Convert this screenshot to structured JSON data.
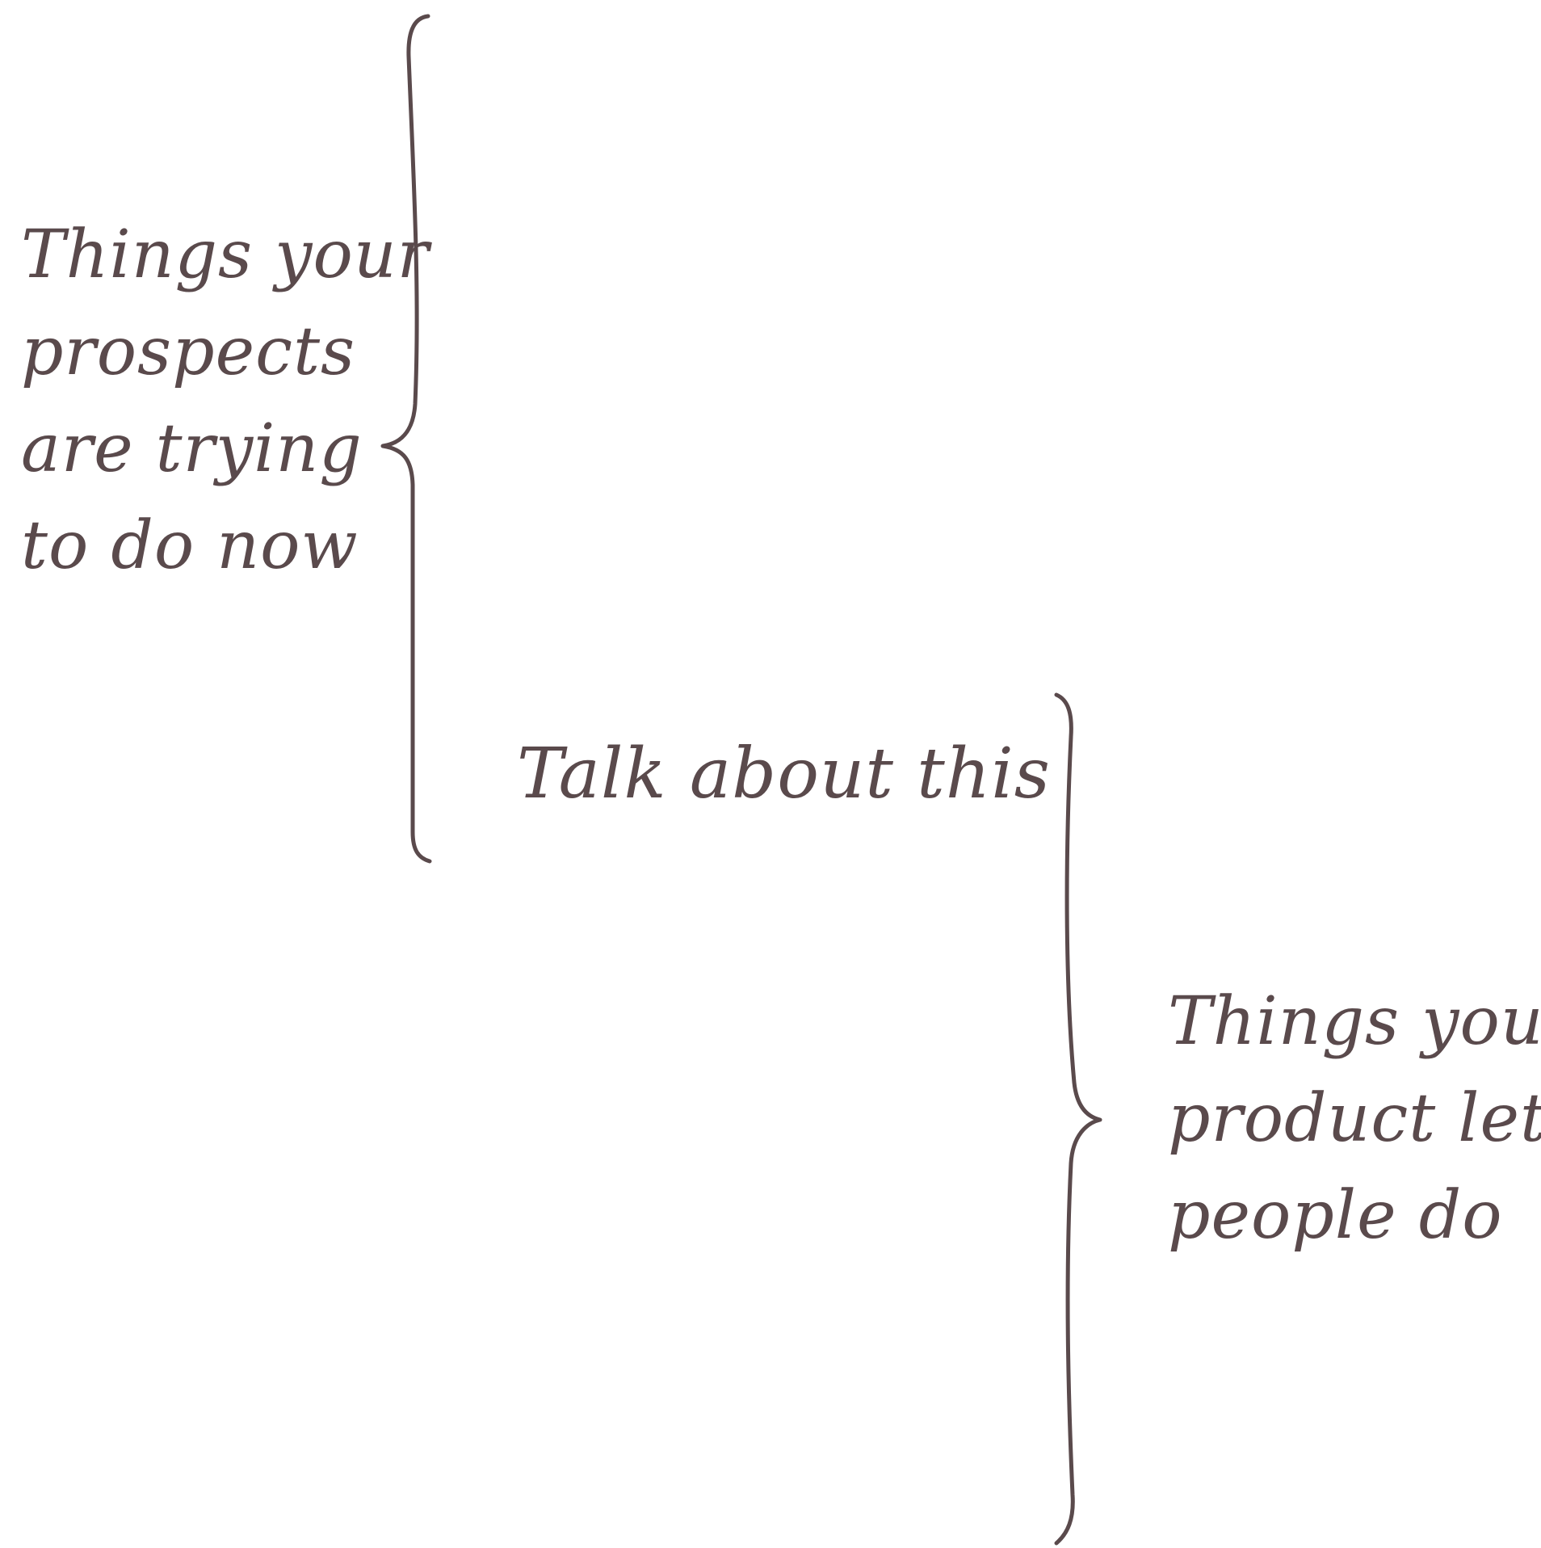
{
  "diagram": {
    "ink_color": "#5a4a4c",
    "labels": {
      "left": {
        "lines": [
          "Things your",
          "prospects",
          "are trying",
          "to do now"
        ]
      },
      "center": {
        "lines": [
          "Talk about this"
        ]
      },
      "right": {
        "lines": [
          "Things your",
          "product lets",
          "people do"
        ]
      }
    },
    "braces": [
      {
        "name": "left-curly-brace",
        "direction": "right-facing"
      },
      {
        "name": "right-curly-brace",
        "direction": "right-facing"
      }
    ]
  }
}
